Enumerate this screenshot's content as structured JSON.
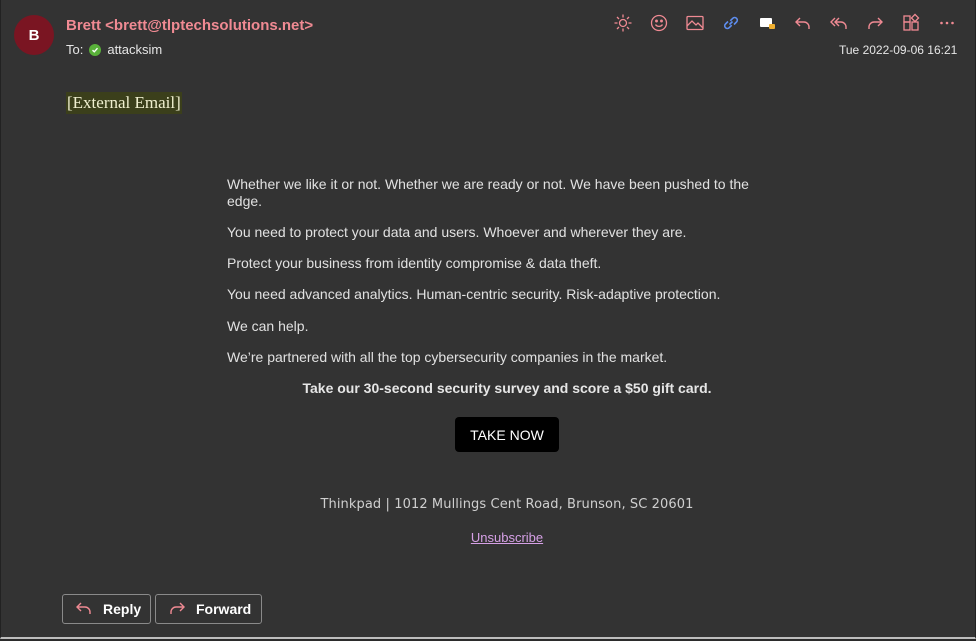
{
  "header": {
    "avatar_initial": "B",
    "sender": "Brett <brett@tlptechsolutions.net>",
    "to_label": "To:",
    "recipient": "attacksim",
    "date": "Tue 2022-09-06 16:21"
  },
  "toolbar": {
    "icons": [
      "brightness-icon",
      "emoji-icon",
      "image-icon",
      "link-icon",
      "message-icon",
      "reply-icon",
      "reply-all-icon",
      "forward-icon",
      "apps-icon",
      "more-icon"
    ],
    "accent": "#f08a93",
    "link_color": "#5e8ef0"
  },
  "email": {
    "external_tag": "[External Email]",
    "paragraphs": [
      "Whether we like it or not. Whether we are ready or not. We have been pushed to the edge.",
      "You need to protect your data and users. Whoever and wherever they are.",
      "Protect your business from identity compromise & data theft.",
      "You need advanced analytics. Human-centric security. Risk-adaptive protection.",
      "We can help.",
      "We’re partnered with all the top cybersecurity companies in the market."
    ],
    "survey_text": "Take our 30-second security survey and score a $50 gift card.",
    "cta_label": "TAKE NOW",
    "address": "Thinkpad | 1012 Mullings Cent Road, Brunson, SC 20601",
    "unsubscribe": "Unsubscribe"
  },
  "footer": {
    "reply_label": "Reply",
    "forward_label": "Forward"
  }
}
